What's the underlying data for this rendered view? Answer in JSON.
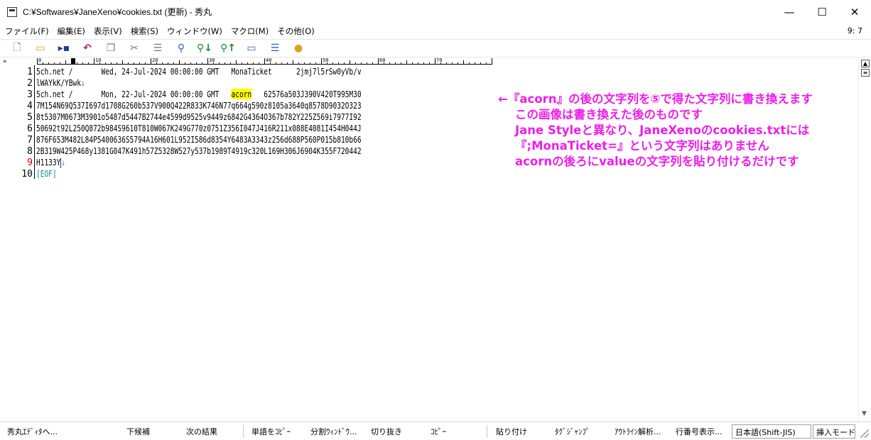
{
  "window": {
    "title": "C:¥Softwares¥JaneXeno¥cookies.txt (更新) - 秀丸",
    "minimize": "—",
    "maximize": "☐",
    "close": "✕"
  },
  "menu": {
    "items": [
      "ファイル(F)",
      "編集(E)",
      "表示(V)",
      "検索(S)",
      "ウィンドウ(W)",
      "マクロ(M)",
      "その他(O)"
    ],
    "cursor_position": "9: 7"
  },
  "toolbar": {
    "icons": [
      "new-file-icon",
      "open-folder-icon",
      "save-icon",
      "undo-icon",
      "copy-icon",
      "cut-icon",
      "paste-icon",
      "search-icon",
      "find-next-icon",
      "find-prev-icon",
      "window-icon",
      "split-icon",
      "macro-icon"
    ]
  },
  "ruler": {
    "labels": [
      "0",
      "10",
      "20",
      "30",
      "40",
      "50",
      "60",
      "70"
    ],
    "margin_mark": "»"
  },
  "editor": {
    "lines": [
      {
        "num": "1",
        "before": "5ch.net /       Wed, 24-Jul-2024 00:00:00 GMT   MonaTicket      2jmj7l5rSw0yVb/v",
        "highlight": "",
        "after": "",
        "eol": ""
      },
      {
        "num": "2",
        "before": "lWAYkK/YBwk",
        "highlight": "",
        "after": "",
        "eol": "↓"
      },
      {
        "num": "3",
        "before": "5ch.net /       Mon, 22-Jul-2024 00:00:00 GMT   ",
        "highlight": "acorn",
        "after": "   62576a503J390V420T995M30",
        "eol": ""
      },
      {
        "num": "4",
        "before": "7M154N69Q537I697d1708G260b537V900Q422R833K746N77q664g590z8105a3640q8578D9032O323",
        "highlight": "",
        "after": "",
        "eol": ""
      },
      {
        "num": "5",
        "before": "8t5307M0673M3901o5487d5447B2744e4599d9525v9449z6842G4364O367b782Y225Z569i7977I92",
        "highlight": "",
        "after": "",
        "eol": ""
      },
      {
        "num": "6",
        "before": "50692t92L250Q872b984S9610T810W067K249G770z0751Z356I047J416R211x088E4081I454H044J",
        "highlight": "",
        "after": "",
        "eol": ""
      },
      {
        "num": "7",
        "before": "876F653M482L84P5400636S5794A16H601L952I586d8354Y6483A3343z256d688P560P015b810b66",
        "highlight": "",
        "after": "",
        "eol": ""
      },
      {
        "num": "8",
        "before": "2B319W425P468y1381G047K491h57Z5328W527y537b1989T4919c320L169H306J6904K355F720442",
        "highlight": "",
        "after": "",
        "eol": ""
      },
      {
        "num": "9",
        "before": "H1133Y",
        "highlight": "",
        "after": "",
        "eol": "↓"
      },
      {
        "num": "10",
        "before": "",
        "highlight": "",
        "after": "",
        "eol": ""
      }
    ],
    "eof_marker": "[EOF]"
  },
  "annotation": {
    "lines": [
      "←『acorn』の後の文字列を⑤で得た文字列に書き換えます",
      "この画像は書き換えた後のものです",
      "Jane Styleと異なり、JaneXenoのcookies.txtには",
      "『;MonaTicket=』という文字列はありません",
      "acornの後ろにvalueの文字列を貼り付けるだけです"
    ],
    "color": "#ee1ee8"
  },
  "statusbar": {
    "items": [
      "秀丸ｴﾃﾞｨﾀへ...",
      "下候補",
      "次の結果",
      "単語をｺﾋﾟｰ",
      "分割ｳｨﾝﾄﾞｳ...",
      "切り抜き",
      "ｺﾋﾟｰ",
      "貼り付け",
      "ﾀｸﾞｼﾞｬﾝﾌﾟ",
      "ｱｳﾄﾗｲﾝ解析...",
      "行番号表示..."
    ],
    "encoding": "日本語(Shift-JIS)",
    "mode": "挿入モード"
  }
}
